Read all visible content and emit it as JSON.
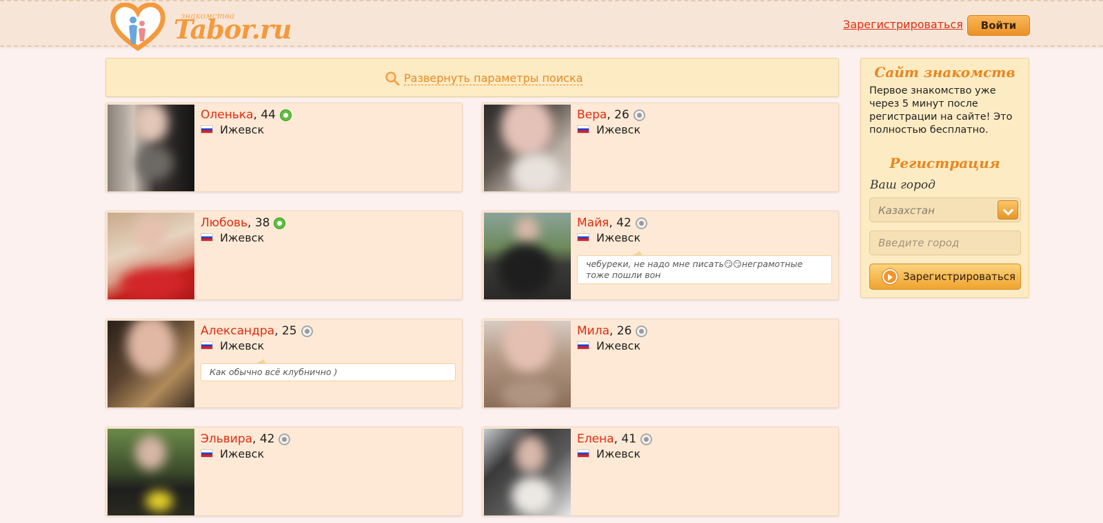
{
  "header": {
    "logo_small": "знакомства",
    "logo_text": "Tabor.ru",
    "register_link": "Зарегистрироваться",
    "login_button": "Войти"
  },
  "search": {
    "expand_label": "Развернуть параметры поиска",
    "icon": "search-icon"
  },
  "profiles": [
    {
      "name": "Оленька",
      "age": ", 44",
      "status": "online",
      "city": "Ижевск",
      "message": ""
    },
    {
      "name": "Вера",
      "age": ", 26",
      "status": "offline",
      "city": "Ижевск",
      "message": ""
    },
    {
      "name": "Любовь",
      "age": ", 38",
      "status": "online",
      "city": "Ижевск",
      "message": ""
    },
    {
      "name": "Майя",
      "age": ", 42",
      "status": "offline",
      "city": "Ижевск",
      "message": "чебуреки, не надо мне писать😏😏неграмотные тоже пошли вон"
    },
    {
      "name": "Александра",
      "age": ", 25",
      "status": "offline",
      "city": "Ижевск",
      "message": "Как обычно всё клубнично )"
    },
    {
      "name": "Мила",
      "age": ", 26",
      "status": "offline",
      "city": "Ижевск",
      "message": ""
    },
    {
      "name": "Эльвира",
      "age": ", 42",
      "status": "offline",
      "city": "Ижевск",
      "message": ""
    },
    {
      "name": "Елена",
      "age": ", 41",
      "status": "offline",
      "city": "Ижевск",
      "message": ""
    }
  ],
  "sidebar": {
    "title": "Сайт знакомств",
    "description": "Первое знакомство уже через 5 минут после регистрации на сайте! Это полностью бесплатно.",
    "reg_title": "Регистрация",
    "city_label": "Ваш город",
    "country_value": "Казахстан",
    "city_placeholder": "Введите город",
    "register_button": "Зарегистрироваться"
  },
  "colors": {
    "accent": "#e8861f",
    "name_red": "#e22b10",
    "card_bg": "#fde9d5"
  }
}
